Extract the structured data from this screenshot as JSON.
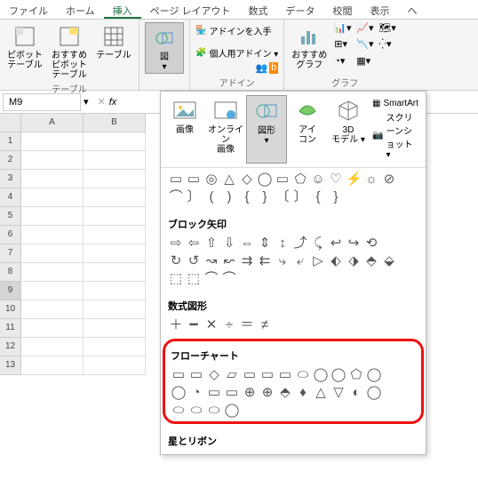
{
  "tabs": {
    "file": "ファイル",
    "home": "ホーム",
    "insert": "挿入",
    "pagelayout": "ページ レイアウト",
    "formulas": "数式",
    "data": "データ",
    "review": "校閲",
    "view": "表示",
    "he": "ヘ"
  },
  "groups": {
    "tables": "テーブル",
    "illustrations": "",
    "addins": "アドイン",
    "charts": "グラフ"
  },
  "buttons": {
    "pivot": "ピボット\nテーブル",
    "recpivot": "おすすめ\nピボットテーブル",
    "table": "テーブル",
    "zu": "図",
    "getaddins": "アドインを入手",
    "myaddins": "個人用アドイン ▾",
    "recchart": "おすすめ\nグラフ",
    "images": "画像",
    "online": "オンライン\n画像",
    "shapes": "図形",
    "icons": "アイ\nコン",
    "3d": "3D\nモデル ▾",
    "smartart": "SmartArt",
    "screenshot": "スクリーンショット ▾"
  },
  "namebox": "M9",
  "cols": [
    "A",
    "B"
  ],
  "rows": [
    "1",
    "2",
    "3",
    "4",
    "5",
    "6",
    "7",
    "8",
    "9",
    "10",
    "11",
    "12",
    "13"
  ],
  "selected_row": "9",
  "cats": {
    "blockarrow": "ブロック矢印",
    "equation": "数式図形",
    "flowchart": "フローチャート",
    "stars": "星とリボン"
  },
  "shapes": {
    "top1": [
      "▭",
      "▭",
      "◎",
      "△",
      "◇",
      "◯",
      "▭",
      "⬠",
      "☺",
      "♡",
      "⚡",
      "☼",
      "⊘"
    ],
    "top2": [
      "⌒",
      "〕",
      "(",
      ")",
      "{",
      "}",
      "〔",
      "〕",
      "{",
      "}"
    ],
    "arrow1": [
      "⇨",
      "⇦",
      "⇧",
      "⇩",
      "⇔",
      "⇕",
      "↕",
      "⤴",
      "⤹",
      "↩",
      "↪",
      "⟲"
    ],
    "arrow2": [
      "↻",
      "↺",
      "↝",
      "↜",
      "⇉",
      "⇇",
      "⤷",
      "⤶",
      "▷",
      "⬖",
      "⬗",
      "⬘",
      "⬙"
    ],
    "arrow3": [
      "⬚",
      "⬚",
      "⌒",
      "⌒"
    ],
    "eq": [
      "＋",
      "━",
      "✕",
      "÷",
      "＝",
      "≠"
    ],
    "flow1": [
      "▭",
      "▭",
      "◇",
      "▱",
      "▭",
      "▭",
      "▭",
      "⬭",
      "◯",
      "◯",
      "⬠",
      "◯"
    ],
    "flow2": [
      "◯",
      "◔",
      "▭",
      "▭",
      "⊕",
      "⊕",
      "⬘",
      "♦",
      "△",
      "▽",
      "◐",
      "◯"
    ],
    "flow3": [
      "⬭",
      "⬭",
      "⬭",
      "◯"
    ]
  }
}
